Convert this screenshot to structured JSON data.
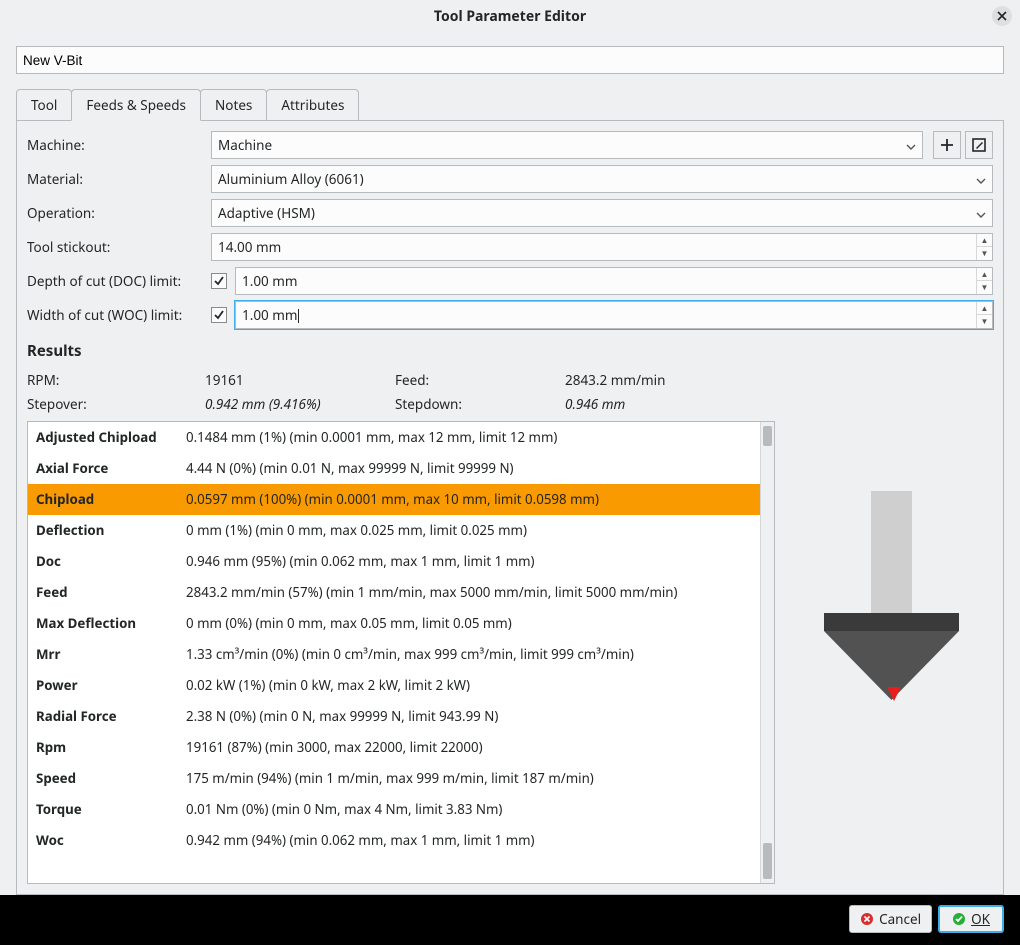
{
  "window": {
    "title": "Tool Parameter Editor"
  },
  "tool_name": "New V-Bit",
  "tabs": {
    "tool": "Tool",
    "feeds": "Feeds & Speeds",
    "notes": "Notes",
    "attributes": "Attributes"
  },
  "labels": {
    "machine": "Machine:",
    "material": "Material:",
    "operation": "Operation:",
    "stickout": "Tool stickout:",
    "doc_limit": "Depth of cut (DOC) limit:",
    "woc_limit": "Width of cut (WOC) limit:",
    "results": "Results",
    "rpm": "RPM:",
    "feed": "Feed:",
    "stepover": "Stepover:",
    "stepdown": "Stepdown:"
  },
  "values": {
    "machine": "Machine",
    "material": "Aluminium Alloy (6061)",
    "operation": "Adaptive (HSM)",
    "stickout": "14.00 mm",
    "doc": "1.00 mm",
    "woc": "1.00 mm"
  },
  "results_header": {
    "rpm": "19161",
    "feed": "2843.2 mm/min",
    "stepover": "0.942 mm (9.416%)",
    "stepdown": "0.946 mm"
  },
  "results_rows": [
    {
      "key": "Adjusted Chipload",
      "val": "0.1484 mm (1%) (min 0.0001 mm, max 12 mm, limit 12 mm)",
      "hl": false
    },
    {
      "key": "Axial Force",
      "val": "4.44 N (0%) (min 0.01 N, max 99999 N, limit 99999 N)",
      "hl": false
    },
    {
      "key": "Chipload",
      "val": "0.0597 mm (100%) (min 0.0001 mm, max 10 mm, limit 0.0598 mm)",
      "hl": true
    },
    {
      "key": "Deflection",
      "val": "0 mm (1%) (min 0 mm, max 0.025 mm, limit 0.025 mm)",
      "hl": false
    },
    {
      "key": "Doc",
      "val": "0.946 mm (95%) (min 0.062 mm, max 1 mm, limit 1 mm)",
      "hl": false
    },
    {
      "key": "Feed",
      "val": "2843.2 mm/min (57%) (min 1 mm/min, max 5000 mm/min, limit 5000 mm/min)",
      "hl": false
    },
    {
      "key": "Max Deflection",
      "val": "0 mm (0%) (min 0 mm, max 0.05 mm, limit 0.05 mm)",
      "hl": false
    },
    {
      "key": "Mrr",
      "val": "1.33 cm³/min (0%) (min 0 cm³/min, max 999 cm³/min, limit 999 cm³/min)",
      "hl": false
    },
    {
      "key": "Power",
      "val": "0.02 kW (1%) (min 0 kW, max 2 kW, limit 2 kW)",
      "hl": false
    },
    {
      "key": "Radial Force",
      "val": "2.38 N (0%) (min 0 N, max 99999 N, limit 943.99 N)",
      "hl": false
    },
    {
      "key": "Rpm",
      "val": "19161 (87%) (min 3000, max 22000, limit 22000)",
      "hl": false
    },
    {
      "key": "Speed",
      "val": "175 m/min (94%) (min 1 m/min, max 999 m/min, limit 187 m/min)",
      "hl": false
    },
    {
      "key": "Torque",
      "val": "0.01 Nm (0%) (min 0 Nm, max 4 Nm, limit 3.83 Nm)",
      "hl": false
    },
    {
      "key": "Woc",
      "val": "0.942 mm (94%) (min 0.062 mm, max 1 mm, limit 1 mm)",
      "hl": false
    }
  ],
  "footer": {
    "cancel": "Cancel",
    "ok": "OK"
  }
}
